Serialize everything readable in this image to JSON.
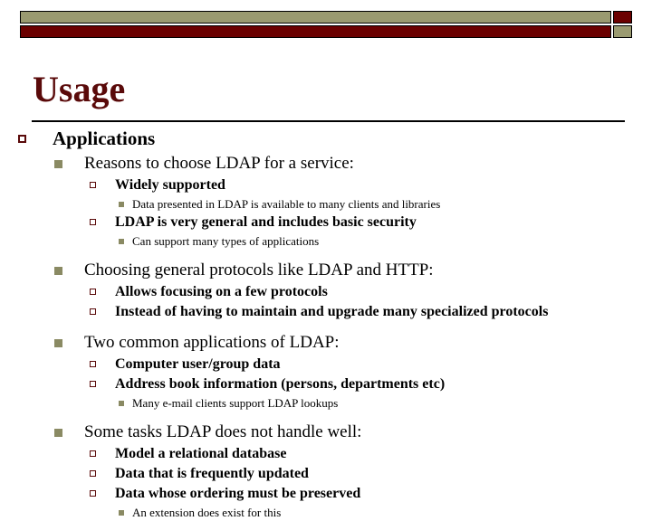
{
  "slide": {
    "title": "Usage",
    "theme": {
      "olive": "#9a9a70",
      "olive_bullet": "#8a8a63",
      "maroon": "#6b0000",
      "title_color": "#5a0a0a",
      "text_color": "#000000",
      "background": "#ffffff"
    },
    "decor": {
      "top_band_long_name": "olive-band",
      "top_band_cap_name": "maroon-cap",
      "bottom_band_long_name": "maroon-band",
      "bottom_band_cap_name": "olive-cap"
    },
    "outline": [
      {
        "level": 1,
        "marker": "hollow-square-maroon",
        "text": "Applications"
      },
      {
        "level": 2,
        "marker": "filled-square-olive",
        "text": "Reasons to choose LDAP for a service:"
      },
      {
        "level": 3,
        "marker": "hollow-square-maroon-small",
        "text": "Widely supported"
      },
      {
        "level": 4,
        "marker": "filled-square-olive-small",
        "text": "Data presented in LDAP is available to many clients and libraries"
      },
      {
        "level": 3,
        "marker": "hollow-square-maroon-small",
        "text": "LDAP is very general and includes basic security"
      },
      {
        "level": 4,
        "marker": "filled-square-olive-small",
        "text": "Can support many types of applications"
      },
      {
        "level": 2,
        "marker": "filled-square-olive",
        "text": "Choosing general protocols like LDAP and HTTP:"
      },
      {
        "level": 3,
        "marker": "hollow-square-maroon-small",
        "text": "Allows focusing on a few protocols"
      },
      {
        "level": 3,
        "marker": "hollow-square-maroon-small",
        "text": "Instead of having to maintain and upgrade many specialized protocols"
      },
      {
        "level": 2,
        "marker": "filled-square-olive",
        "text": "Two common applications of LDAP:"
      },
      {
        "level": 3,
        "marker": "hollow-square-maroon-small",
        "text": "Computer user/group data"
      },
      {
        "level": 3,
        "marker": "hollow-square-maroon-small",
        "text": "Address book information (persons, departments etc)"
      },
      {
        "level": 4,
        "marker": "filled-square-olive-small",
        "text": "Many e-mail clients support LDAP lookups"
      },
      {
        "level": 2,
        "marker": "filled-square-olive",
        "text": "Some tasks LDAP does not handle well:"
      },
      {
        "level": 3,
        "marker": "hollow-square-maroon-small",
        "text": "Model a relational database"
      },
      {
        "level": 3,
        "marker": "hollow-square-maroon-small",
        "text": "Data that is frequently updated"
      },
      {
        "level": 3,
        "marker": "hollow-square-maroon-small",
        "text": "Data whose ordering must be preserved"
      },
      {
        "level": 4,
        "marker": "filled-square-olive-small",
        "text": "An extension does exist for this"
      }
    ]
  }
}
